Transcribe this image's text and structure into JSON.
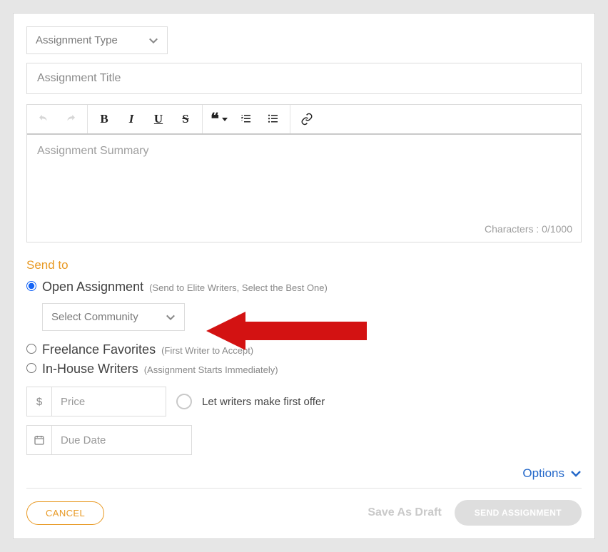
{
  "assignment_type": {
    "placeholder": "Assignment Type"
  },
  "title": {
    "placeholder": "Assignment Title"
  },
  "summary": {
    "placeholder": "Assignment Summary",
    "char_count_label": "Characters : 0/1000"
  },
  "send_to": {
    "heading": "Send to",
    "open": {
      "label": "Open Assignment",
      "hint": "(Send to Elite Writers, Select the Best One)"
    },
    "community": {
      "placeholder": "Select Community"
    },
    "freelance": {
      "label": "Freelance Favorites",
      "hint": "(First Writer to Accept)"
    },
    "inhouse": {
      "label": "In-House Writers",
      "hint": "(Assignment Starts Immediately)"
    }
  },
  "price": {
    "prefix": "$",
    "placeholder": "Price"
  },
  "first_offer_label": "Let writers make first offer",
  "due_date": {
    "placeholder": "Due Date"
  },
  "options_label": "Options",
  "footer": {
    "cancel": "CANCEL",
    "save_draft": "Save As Draft",
    "send": "SEND ASSIGNMENT"
  }
}
